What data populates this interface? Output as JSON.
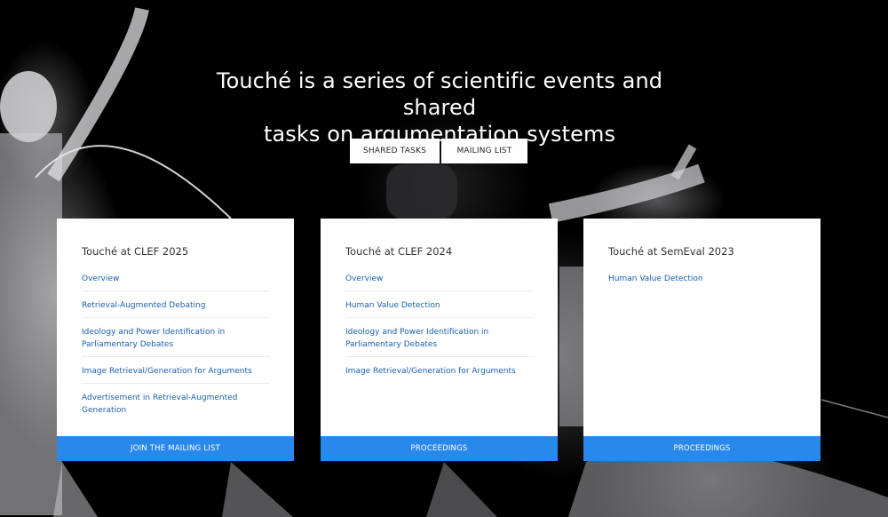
{
  "hero": {
    "headline_line1": "Touché is a series of scientific events and shared",
    "headline_line2": "tasks on argumentation systems",
    "buttons": {
      "shared_tasks": "Shared Tasks",
      "mailing_list": "Mailing List"
    },
    "background_image": "fencing-photo"
  },
  "cards": [
    {
      "title": "Touché at CLEF 2025",
      "links": [
        "Overview",
        "Retrieval-Augmented Debating",
        "Ideology and Power Identification in Parliamentary Debates",
        "Image Retrieval/Generation for Arguments",
        "Advertisement in Retrieval-Augmented Generation"
      ],
      "footer": "Join the mailing list"
    },
    {
      "title": "Touché at CLEF 2024",
      "links": [
        "Overview",
        "Human Value Detection",
        "Ideology and Power Identification in Parliamentary Debates",
        "Image Retrieval/Generation for Arguments"
      ],
      "footer": "Proceedings"
    },
    {
      "title": "Touché at SemEval 2023",
      "links": [
        "Human Value Detection"
      ],
      "footer": "Proceedings"
    }
  ],
  "colors": {
    "accent": "#2888ec",
    "link": "#1b5fae",
    "background": "#000000",
    "card": "#ffffff"
  }
}
